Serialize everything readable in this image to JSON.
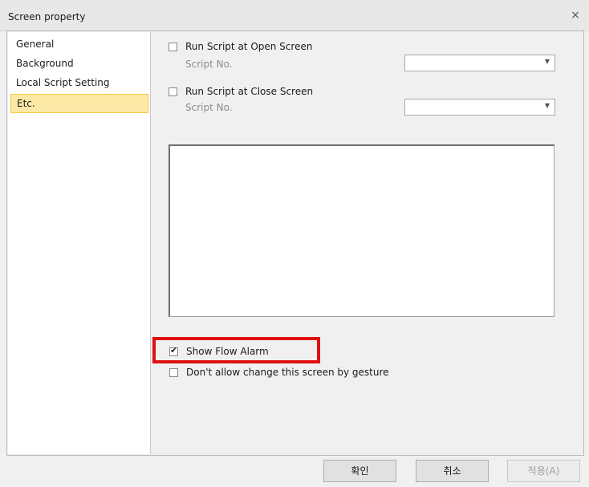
{
  "window": {
    "title": "Screen property",
    "close_glyph": "×"
  },
  "sidebar": {
    "items": [
      {
        "label": "General"
      },
      {
        "label": "Background"
      },
      {
        "label": "Local Script Setting"
      },
      {
        "label": "Etc."
      }
    ],
    "selected": "Etc."
  },
  "etc": {
    "open_script": {
      "label": "Run Script at Open Screen",
      "checked": false,
      "sub_label": "Script No.",
      "value": ""
    },
    "close_script": {
      "label": "Run Script at Close Screen",
      "checked": false,
      "sub_label": "Script No.",
      "value": ""
    },
    "show_flow_alarm": {
      "label": "Show Flow Alarm",
      "checked": true
    },
    "gesture": {
      "label": "Don't allow change this screen by gesture",
      "checked": false
    }
  },
  "buttons": {
    "ok": "확인",
    "cancel": "취소",
    "apply": "적용(A)"
  },
  "colors": {
    "selected_bg": "#fde9a6",
    "highlight": "#e01010"
  }
}
